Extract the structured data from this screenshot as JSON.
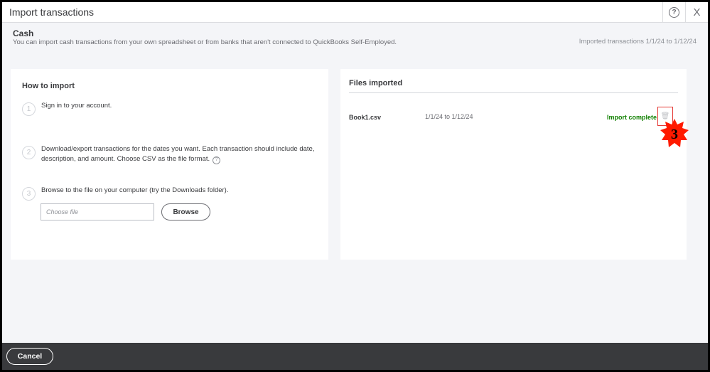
{
  "dialog": {
    "title": "Import transactions",
    "help_icon": "?",
    "close_icon": "X"
  },
  "header": {
    "account": "Cash",
    "description": "You can import cash transactions from your own spreadsheet or from banks that aren't connected to QuickBooks Self-Employed.",
    "imported_range": "Imported transactions 1/1/24 to 1/12/24"
  },
  "how_to": {
    "title": "How to import",
    "steps": [
      {
        "num": "1",
        "text": "Sign in to your account."
      },
      {
        "num": "2",
        "text": "Download/export transactions for the dates you want. Each transaction should include date, description, and amount. Choose CSV as the file format."
      },
      {
        "num": "3",
        "text": "Browse to the file on your computer (try the Downloads folder)."
      }
    ],
    "file_placeholder": "Choose file",
    "browse_label": "Browse"
  },
  "files": {
    "title": "Files imported",
    "items": [
      {
        "name": "Book1.csv",
        "range": "1/1/24 to 1/12/24",
        "status": "Import complete"
      }
    ]
  },
  "annotation": {
    "label": "3",
    "color": "#ff1a00"
  },
  "footer": {
    "cancel_label": "Cancel"
  }
}
